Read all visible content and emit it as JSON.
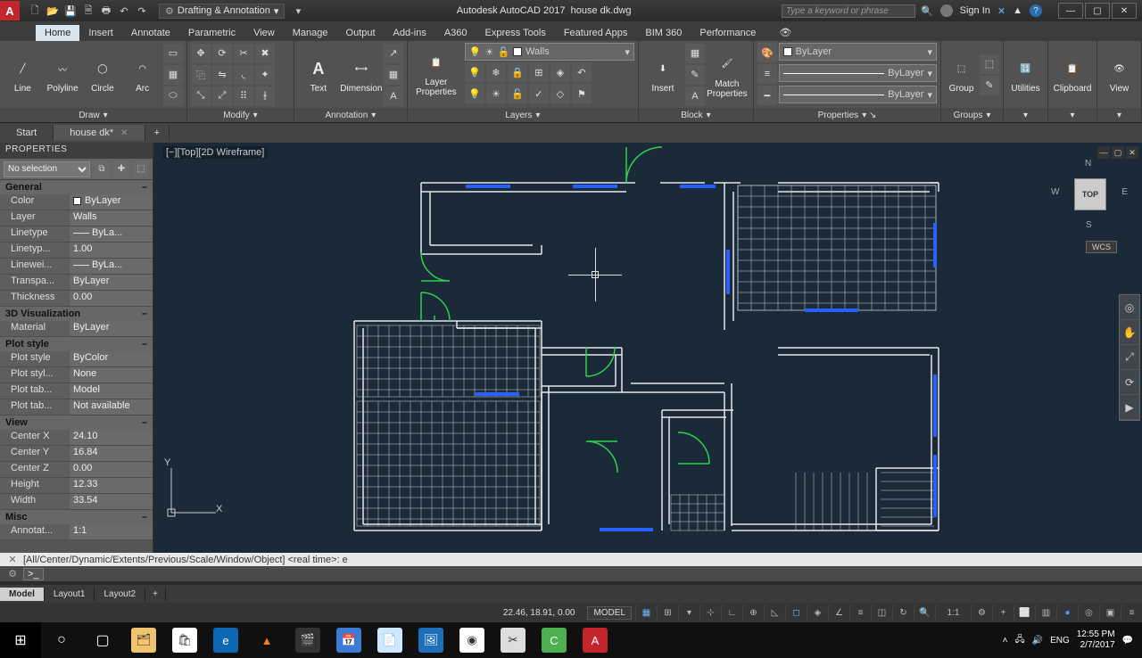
{
  "title": {
    "app": "Autodesk AutoCAD 2017",
    "file": "house dk.dwg"
  },
  "workspace": "Drafting & Annotation",
  "searchPlaceholder": "Type a keyword or phrase",
  "signIn": "Sign In",
  "ribbonTabs": [
    "Home",
    "Insert",
    "Annotate",
    "Parametric",
    "View",
    "Manage",
    "Output",
    "Add-ins",
    "A360",
    "Express Tools",
    "Featured Apps",
    "BIM 360",
    "Performance"
  ],
  "panels": {
    "draw": {
      "title": "Draw",
      "line": "Line",
      "polyline": "Polyline",
      "circle": "Circle",
      "arc": "Arc"
    },
    "modify": {
      "title": "Modify"
    },
    "annotation": {
      "title": "Annotation",
      "text": "Text",
      "dimension": "Dimension"
    },
    "layers": {
      "title": "Layers",
      "layerProps": "Layer\nProperties",
      "current": "Walls"
    },
    "block": {
      "title": "Block",
      "insert": "Insert",
      "match": "Match\nProperties"
    },
    "properties": {
      "title": "Properties",
      "bylayer": "ByLayer"
    },
    "groups": {
      "title": "Groups",
      "group": "Group"
    },
    "utilities": {
      "title": "Utilities"
    },
    "clipboard": {
      "title": "Clipboard"
    },
    "view": {
      "title": "View"
    }
  },
  "fileTabs": {
    "start": "Start",
    "active": "house dk*"
  },
  "properties": {
    "header": "PROPERTIES",
    "selection": "No selection",
    "sections": {
      "general": {
        "title": "General",
        "rows": [
          {
            "k": "Color",
            "v": "ByLayer",
            "sw": true
          },
          {
            "k": "Layer",
            "v": "Walls"
          },
          {
            "k": "Linetype",
            "v": "ByLa...",
            "ln": true
          },
          {
            "k": "Linetyp...",
            "v": "1.00"
          },
          {
            "k": "Linewei...",
            "v": "ByLa...",
            "ln": true
          },
          {
            "k": "Transpa...",
            "v": "ByLayer"
          },
          {
            "k": "Thickness",
            "v": "0.00"
          }
        ]
      },
      "viz": {
        "title": "3D Visualization",
        "rows": [
          {
            "k": "Material",
            "v": "ByLayer"
          }
        ]
      },
      "plot": {
        "title": "Plot style",
        "rows": [
          {
            "k": "Plot style",
            "v": "ByColor"
          },
          {
            "k": "Plot styl...",
            "v": "None"
          },
          {
            "k": "Plot tab...",
            "v": "Model"
          },
          {
            "k": "Plot tab...",
            "v": "Not available"
          }
        ]
      },
      "view": {
        "title": "View",
        "rows": [
          {
            "k": "Center X",
            "v": "24.10"
          },
          {
            "k": "Center Y",
            "v": "16.84"
          },
          {
            "k": "Center Z",
            "v": "0.00"
          },
          {
            "k": "Height",
            "v": "12.33"
          },
          {
            "k": "Width",
            "v": "33.54"
          }
        ]
      },
      "misc": {
        "title": "Misc",
        "rows": [
          {
            "k": "Annotat...",
            "v": "1:1"
          }
        ]
      }
    }
  },
  "viewport": {
    "label": "[−][Top][2D Wireframe]",
    "wcs": "WCS",
    "cubeTop": "TOP",
    "compass": {
      "n": "N",
      "s": "S",
      "e": "E",
      "w": "W"
    }
  },
  "command": {
    "history": "[All/Center/Dynamic/Extents/Previous/Scale/Window/Object] <real time>: e",
    "prompt": ">_"
  },
  "modelTabs": {
    "model": "Model",
    "l1": "Layout1",
    "l2": "Layout2"
  },
  "status": {
    "coords": "22.46, 18.91, 0.00",
    "model": "MODEL",
    "scale": "1:1"
  },
  "taskbar": {
    "tray": {
      "lang": "ENG",
      "time": "12:55 PM",
      "date": "2/7/2017"
    }
  },
  "ucs": {
    "x": "X",
    "y": "Y"
  }
}
